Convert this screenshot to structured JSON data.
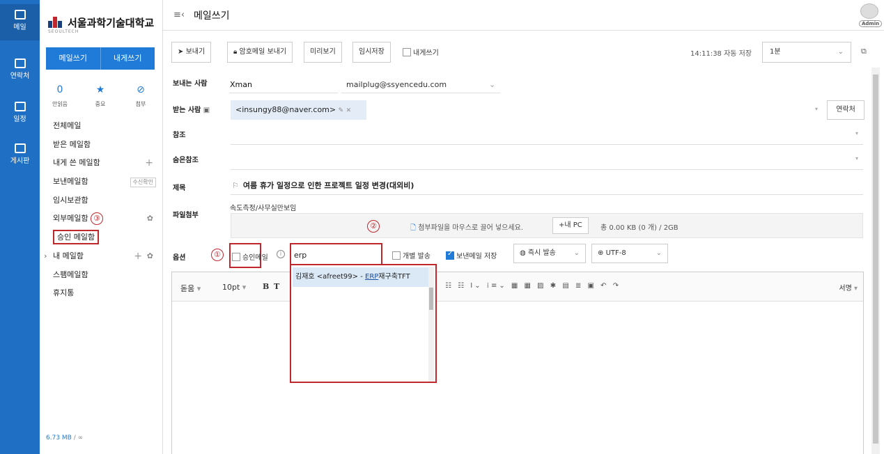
{
  "rail": {
    "items": [
      {
        "label": "메일",
        "icon": "mail-icon"
      },
      {
        "label": "연락처",
        "icon": "contacts-icon"
      },
      {
        "label": "일정",
        "icon": "calendar-icon"
      },
      {
        "label": "게시판",
        "icon": "board-icon"
      }
    ]
  },
  "sidebar": {
    "logo_text": "서울과학기술대학교",
    "logo_sub": "SEOULTECH",
    "compose_label": "메일쓰기",
    "self_compose_label": "내게쓰기",
    "stats": [
      {
        "value": "0",
        "label": "안읽음"
      },
      {
        "value": "★",
        "label": "중요"
      },
      {
        "value": "⊘",
        "label": "첨부"
      }
    ],
    "folders": [
      {
        "label": "전체메일"
      },
      {
        "label": "받은 메일함"
      },
      {
        "label": "내게 쓴 메일함"
      },
      {
        "label": "보낸메일함",
        "tag": "수신확인"
      },
      {
        "label": "임시보관함"
      },
      {
        "label": "외부메일함"
      },
      {
        "label": "승인 메일함"
      },
      {
        "label": "내 메일함"
      },
      {
        "label": "스팸메일함"
      },
      {
        "label": "휴지통"
      }
    ],
    "storage_used": "6.73 MB",
    "storage_sep": "/",
    "storage_total": "∞"
  },
  "header": {
    "title": "메일쓰기",
    "avatar_label": "Admin"
  },
  "toolbar": {
    "send": "보내기",
    "secure_send": "암호메일 보내기",
    "preview": "미리보기",
    "draft": "임시저장",
    "self_send": "내게쓰기",
    "autosave": "14:11:38 자동 저장",
    "interval": "1분"
  },
  "form": {
    "sender_label": "보내는 사람",
    "sender_name": "Xman",
    "sender_email": "mailplug@ssyencedu.com",
    "to_label": "받는 사람",
    "to_chip": "<insungy88@naver.com>",
    "contacts_button": "연락처",
    "cc_label": "참조",
    "bcc_label": "숨은참조",
    "subject_label": "제목",
    "subject": "여름 휴가 일정으로 인한 프로젝트 일정 변경(대외비)",
    "attach_label": "파일첨부",
    "attach_note": "속도측정/사무실만보임",
    "drop_message": "첨부파일을 마우스로 끌어 넣으세요.",
    "pc_button": "+내 PC",
    "size_info": "총 0.00 KB (0 개) / 2GB",
    "options_label": "옵션",
    "approve_label": "승인메일",
    "approver_query": "erp",
    "individual_send": "개별 발송",
    "save_sent": "보낸메일 저장",
    "send_timing": "즉시 발송",
    "encoding": "UTF-8"
  },
  "dropdown": {
    "item_prefix": "김재호 <afreet99> - ",
    "item_match": "ERP",
    "item_suffix": "재구축TFT"
  },
  "editor": {
    "font": "돋움",
    "size": "10pt",
    "signature": "서명"
  },
  "annotations": {
    "one": "①",
    "two": "②",
    "three": "③"
  },
  "colors": {
    "brand_blue": "#1f6fc4",
    "button_blue": "#1f7ad8",
    "annotation_red": "#c0272d"
  }
}
